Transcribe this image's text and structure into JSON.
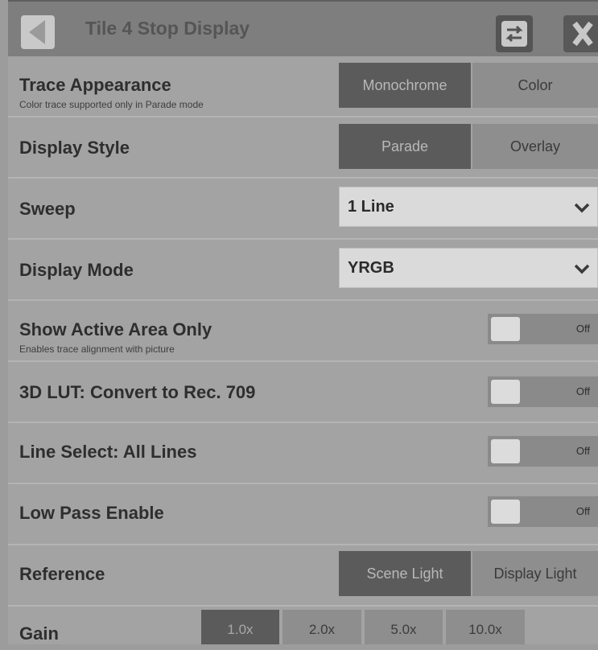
{
  "header": {
    "title": "Tile 4 Stop Display",
    "back_icon": "back-arrow-icon",
    "swap_icon": "swap-arrows-icon",
    "close_icon": "close-x-icon"
  },
  "rows": {
    "trace_appearance": {
      "label": "Trace Appearance",
      "sub": "Color trace supported only in Parade mode",
      "options": [
        "Monochrome",
        "Color"
      ],
      "selected": "Monochrome"
    },
    "display_style": {
      "label": "Display Style",
      "options": [
        "Parade",
        "Overlay"
      ],
      "selected": "Parade"
    },
    "sweep": {
      "label": "Sweep",
      "value": "1 Line"
    },
    "display_mode": {
      "label": "Display Mode",
      "value": "YRGB"
    },
    "show_active_area": {
      "label": "Show Active Area Only",
      "sub": "Enables trace alignment with picture",
      "state": "Off"
    },
    "lut_convert": {
      "label": "3D LUT: Convert to Rec. 709",
      "state": "Off"
    },
    "line_select": {
      "label": "Line Select: All Lines",
      "state": "Off"
    },
    "low_pass": {
      "label": "Low Pass Enable",
      "state": "Off"
    },
    "reference": {
      "label": "Reference",
      "options": [
        "Scene Light",
        "Display Light"
      ],
      "selected": "Scene Light"
    },
    "gain": {
      "label": "Gain",
      "options": [
        "1.0x",
        "2.0x",
        "5.0x",
        "10.0x"
      ],
      "selected": "1.0x"
    }
  },
  "colors": {
    "header_bg": "#7e7e7e",
    "panel_bg": "#a3a3a3",
    "segment_active": "#5b5b5b",
    "segment_inactive": "#8e8e8e"
  }
}
